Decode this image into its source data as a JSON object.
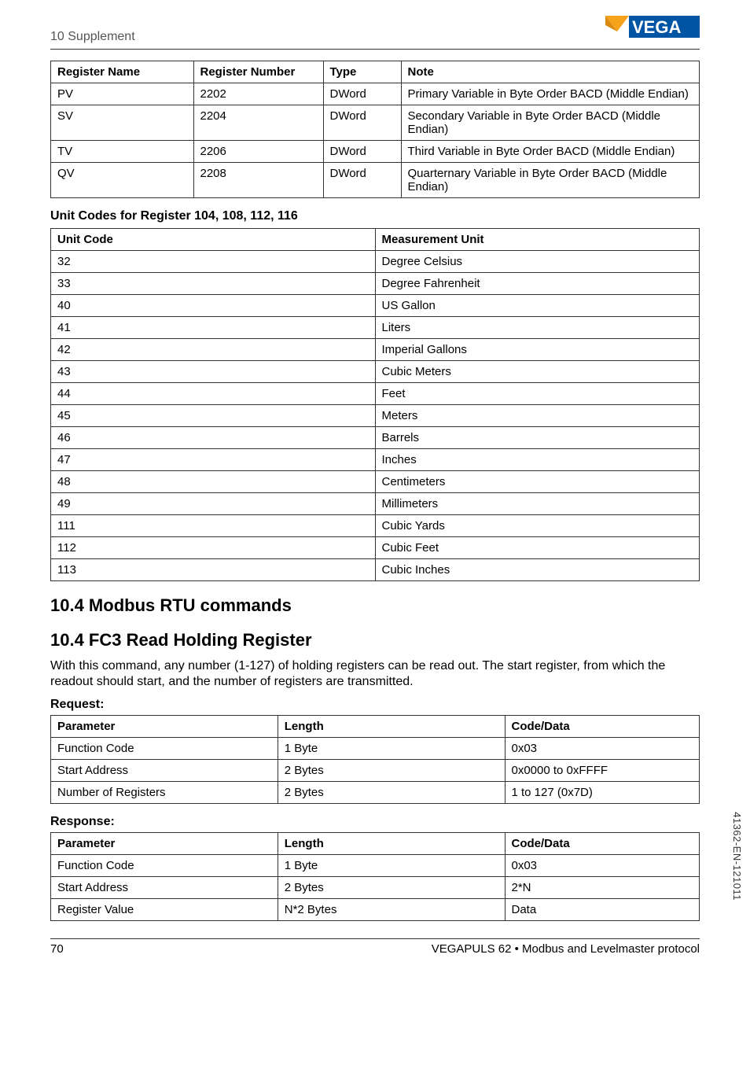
{
  "header": {
    "breadcrumb": "10 Supplement",
    "logo_text": "VEGA"
  },
  "table1": {
    "headers": [
      "Register Name",
      "Register Number",
      "Type",
      "Note"
    ],
    "rows": [
      [
        "PV",
        "2202",
        "DWord",
        "Primary Variable in Byte Order BACD (Middle Endian)"
      ],
      [
        "SV",
        "2204",
        "DWord",
        "Secondary Variable in Byte Order BACD (Middle Endian)"
      ],
      [
        "TV",
        "2206",
        "DWord",
        "Third Variable in Byte Order BACD (Middle Endian)"
      ],
      [
        "QV",
        "2208",
        "DWord",
        "Quarternary Variable in Byte Order BACD (Middle Endian)"
      ]
    ]
  },
  "unit_codes_title": "Unit Codes for Register 104, 108, 112, 116",
  "table2": {
    "headers": [
      "Unit Code",
      "Measurement Unit"
    ],
    "rows": [
      [
        "32",
        "Degree Celsius"
      ],
      [
        "33",
        "Degree Fahrenheit"
      ],
      [
        "40",
        "US Gallon"
      ],
      [
        "41",
        "Liters"
      ],
      [
        "42",
        "Imperial Gallons"
      ],
      [
        "43",
        "Cubic Meters"
      ],
      [
        "44",
        "Feet"
      ],
      [
        "45",
        "Meters"
      ],
      [
        "46",
        "Barrels"
      ],
      [
        "47",
        "Inches"
      ],
      [
        "48",
        "Centimeters"
      ],
      [
        "49",
        "Millimeters"
      ],
      [
        "111",
        "Cubic Yards"
      ],
      [
        "112",
        "Cubic Feet"
      ],
      [
        "113",
        "Cubic Inches"
      ]
    ]
  },
  "h_10_4a": "10.4  Modbus RTU commands",
  "h_10_4b": "10.4  FC3 Read Holding Register",
  "para_fc3": "With this command, any number (1-127) of holding registers can be read out. The start register, from which the readout should start, and the number of registers are transmitted.",
  "request_label": "Request:",
  "table3": {
    "headers": [
      "Parameter",
      "Length",
      "Code/Data"
    ],
    "rows": [
      [
        "Function Code",
        "1 Byte",
        "0x03"
      ],
      [
        "Start Address",
        "2 Bytes",
        "0x0000 to 0xFFFF"
      ],
      [
        "Number of Registers",
        "2 Bytes",
        "1 to 127 (0x7D)"
      ]
    ]
  },
  "response_label": "Response:",
  "table4": {
    "headers": [
      "Parameter",
      "Length",
      "Code/Data"
    ],
    "rows": [
      [
        "Function Code",
        "1 Byte",
        "0x03"
      ],
      [
        "Start Address",
        "2 Bytes",
        "2*N"
      ],
      [
        "Register Value",
        "N*2 Bytes",
        "Data"
      ]
    ]
  },
  "footer": {
    "page": "70",
    "doc": "VEGAPULS 62 • Modbus and Levelmaster protocol"
  },
  "side_code": "41362-EN-121011"
}
